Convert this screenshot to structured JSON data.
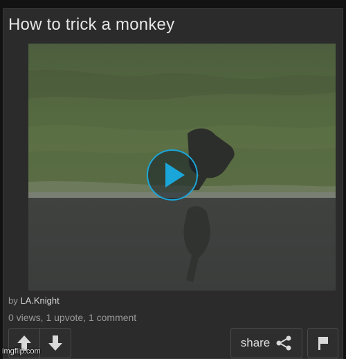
{
  "post": {
    "title": "How to trick a monkey",
    "by_prefix": "by",
    "author": "LA.Knight",
    "stats": "0 views, 1 upvote, 1 comment"
  },
  "actions": {
    "share_label": "share",
    "upvote_icon": "arrow-up-icon",
    "downvote_icon": "arrow-down-icon",
    "share_icon": "share-icon",
    "flag_icon": "flag-icon"
  },
  "video": {
    "play_icon": "play-icon",
    "accent_color": "#1aa6d9"
  },
  "watermark": "imgflip.com"
}
